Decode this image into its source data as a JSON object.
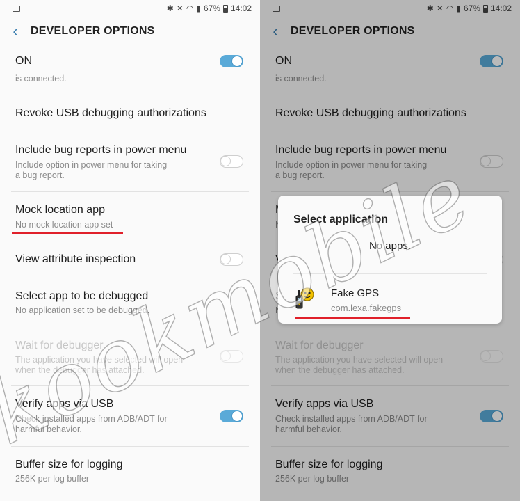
{
  "status": {
    "battery": "67%",
    "time": "14:02"
  },
  "header": {
    "title": "DEVELOPER OPTIONS"
  },
  "master": {
    "label": "ON"
  },
  "partial_subtext": "is connected.",
  "items": {
    "revoke": {
      "title": "Revoke USB debugging authorizations"
    },
    "bugreport": {
      "title": "Include bug reports in power menu",
      "line1": "Include option in power menu for taking",
      "line2": "a bug report."
    },
    "mock": {
      "title": "Mock location app",
      "sub": "No mock location app set"
    },
    "attr": {
      "title": "View attribute inspection"
    },
    "debugapp": {
      "title": "Select app to be debugged",
      "sub": "No application set to be debugged."
    },
    "waitdbg": {
      "title": "Wait for debugger",
      "line1": "The application you have selected will open",
      "line2": "when the debugger has attached."
    },
    "verify": {
      "title": "Verify apps via USB",
      "line1": "Check installed apps from ADB/ADT for",
      "line2": "harmful behavior."
    },
    "buffer": {
      "title": "Buffer size for logging",
      "sub": "256K per log buffer"
    }
  },
  "dialog": {
    "title": "Select application",
    "empty": "No apps.",
    "app": {
      "name": "Fake GPS",
      "package": "com.lexa.fakegps",
      "icon": "fake-gps-icon"
    }
  },
  "watermark": "kookmobile",
  "colors": {
    "accent": "#5aaad8",
    "back_arrow": "#3c7fb0",
    "highlight": "#e0202a"
  }
}
